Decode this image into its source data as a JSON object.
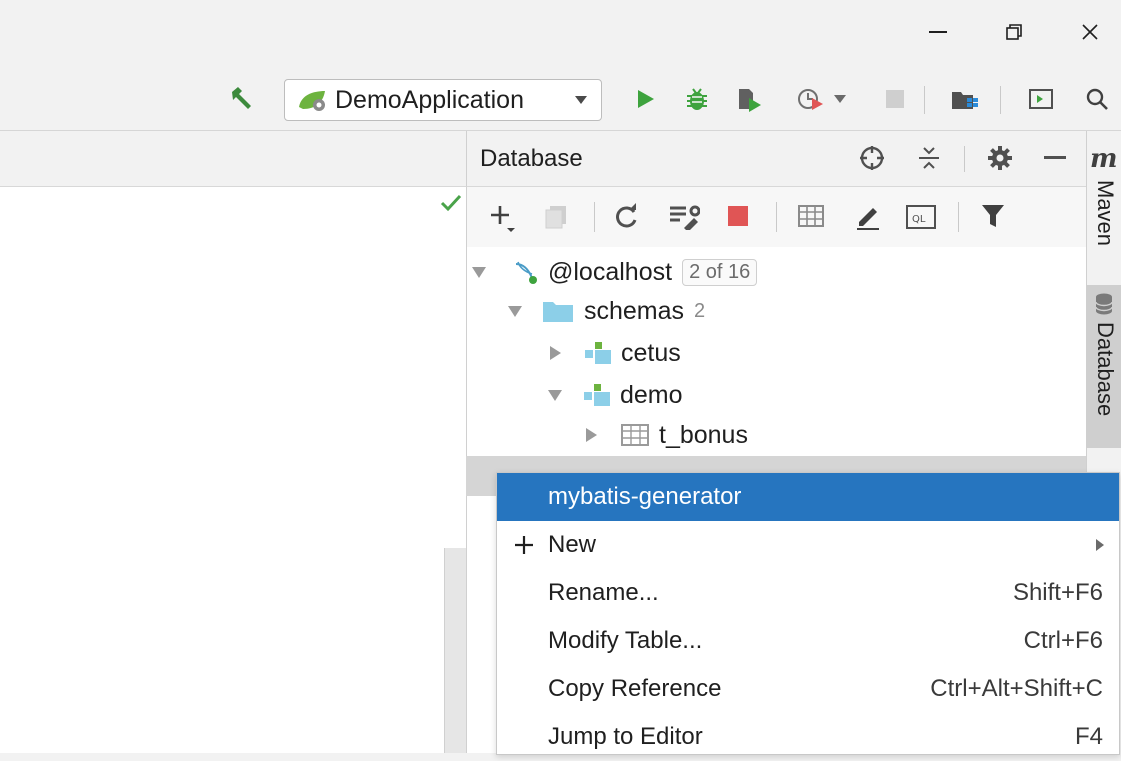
{
  "window": {
    "minimize_glyph": "—",
    "restore_glyph": "❐",
    "close_glyph": "✕"
  },
  "toolbar": {
    "run_config": "DemoApplication",
    "icons": [
      "hammer-icon",
      "run-icon",
      "debug-icon",
      "coverage-icon",
      "profile-icon",
      "stop-icon",
      "project-structure-icon",
      "terminal-icon",
      "search-icon"
    ]
  },
  "database_panel": {
    "title": "Database",
    "tree": {
      "host": {
        "label": "@localhost",
        "badge": "2 of 16"
      },
      "schemas": {
        "label": "schemas",
        "count": "2"
      },
      "cetus": {
        "label": "cetus"
      },
      "demo": {
        "label": "demo"
      },
      "t_bonus": {
        "label": "t_bonus"
      }
    }
  },
  "side_tabs": {
    "maven_letter": "m",
    "maven": "Maven",
    "database": "Database"
  },
  "context_menu": {
    "items": [
      {
        "label": "mybatis-generator",
        "shortcut": "",
        "selected": true
      },
      {
        "label": "New",
        "shortcut": "",
        "submenu": true
      },
      {
        "label": "Rename...",
        "shortcut": "Shift+F6",
        "mnemonic": "R"
      },
      {
        "label": "Modify Table...",
        "shortcut": "Ctrl+F6"
      },
      {
        "label": "Copy Reference",
        "shortcut": "Ctrl+Alt+Shift+C",
        "mnemonic": "y"
      },
      {
        "label": "Jump to Editor",
        "shortcut": "F4"
      }
    ]
  },
  "colors": {
    "selection": "#2675bf",
    "run_green": "#3ea33e",
    "stop_red": "#e05555",
    "folder_blue": "#8ccfe8"
  }
}
